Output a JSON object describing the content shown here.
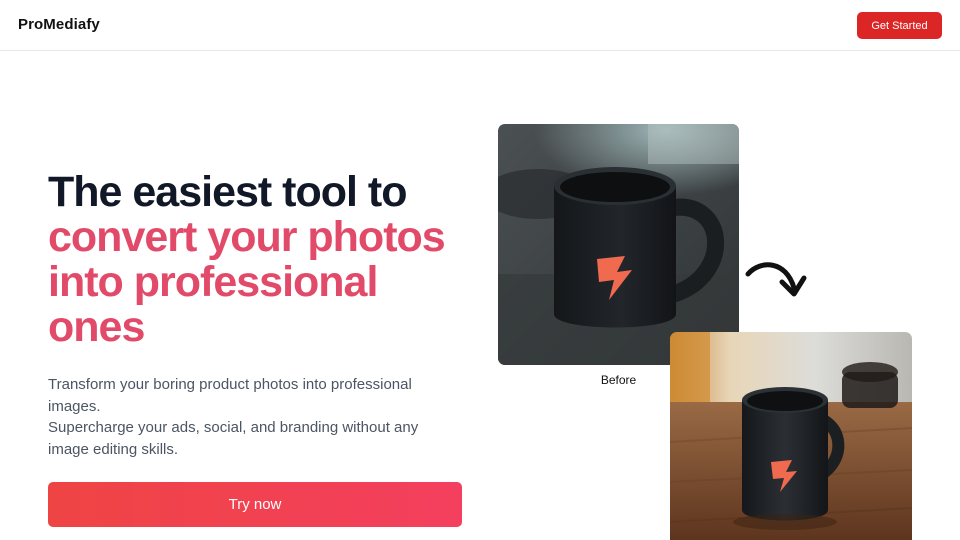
{
  "header": {
    "brand": "ProMediafy",
    "cta_label": "Get Started"
  },
  "hero": {
    "title_line1": "The easiest tool to",
    "title_accent_lines": [
      "convert your photos",
      "into professional",
      "ones"
    ],
    "subtitle_line1": "Transform your boring product photos into professional images.",
    "subtitle_line2": "Supercharge your ads, social, and branding without any image editing skills.",
    "cta_label": "Try now"
  },
  "showcase": {
    "before_label": "Before",
    "before_image": "black-mug-before-photo",
    "after_image": "black-mug-after-photo",
    "arrow_icon": "curved-arrow-icon"
  },
  "colors": {
    "accent": "#e24a6a",
    "button_red": "#dc2626",
    "gradient_start": "#ef4444",
    "gradient_end": "#f43f5e",
    "heading_dark": "#111827",
    "body_text": "#4b5563"
  }
}
